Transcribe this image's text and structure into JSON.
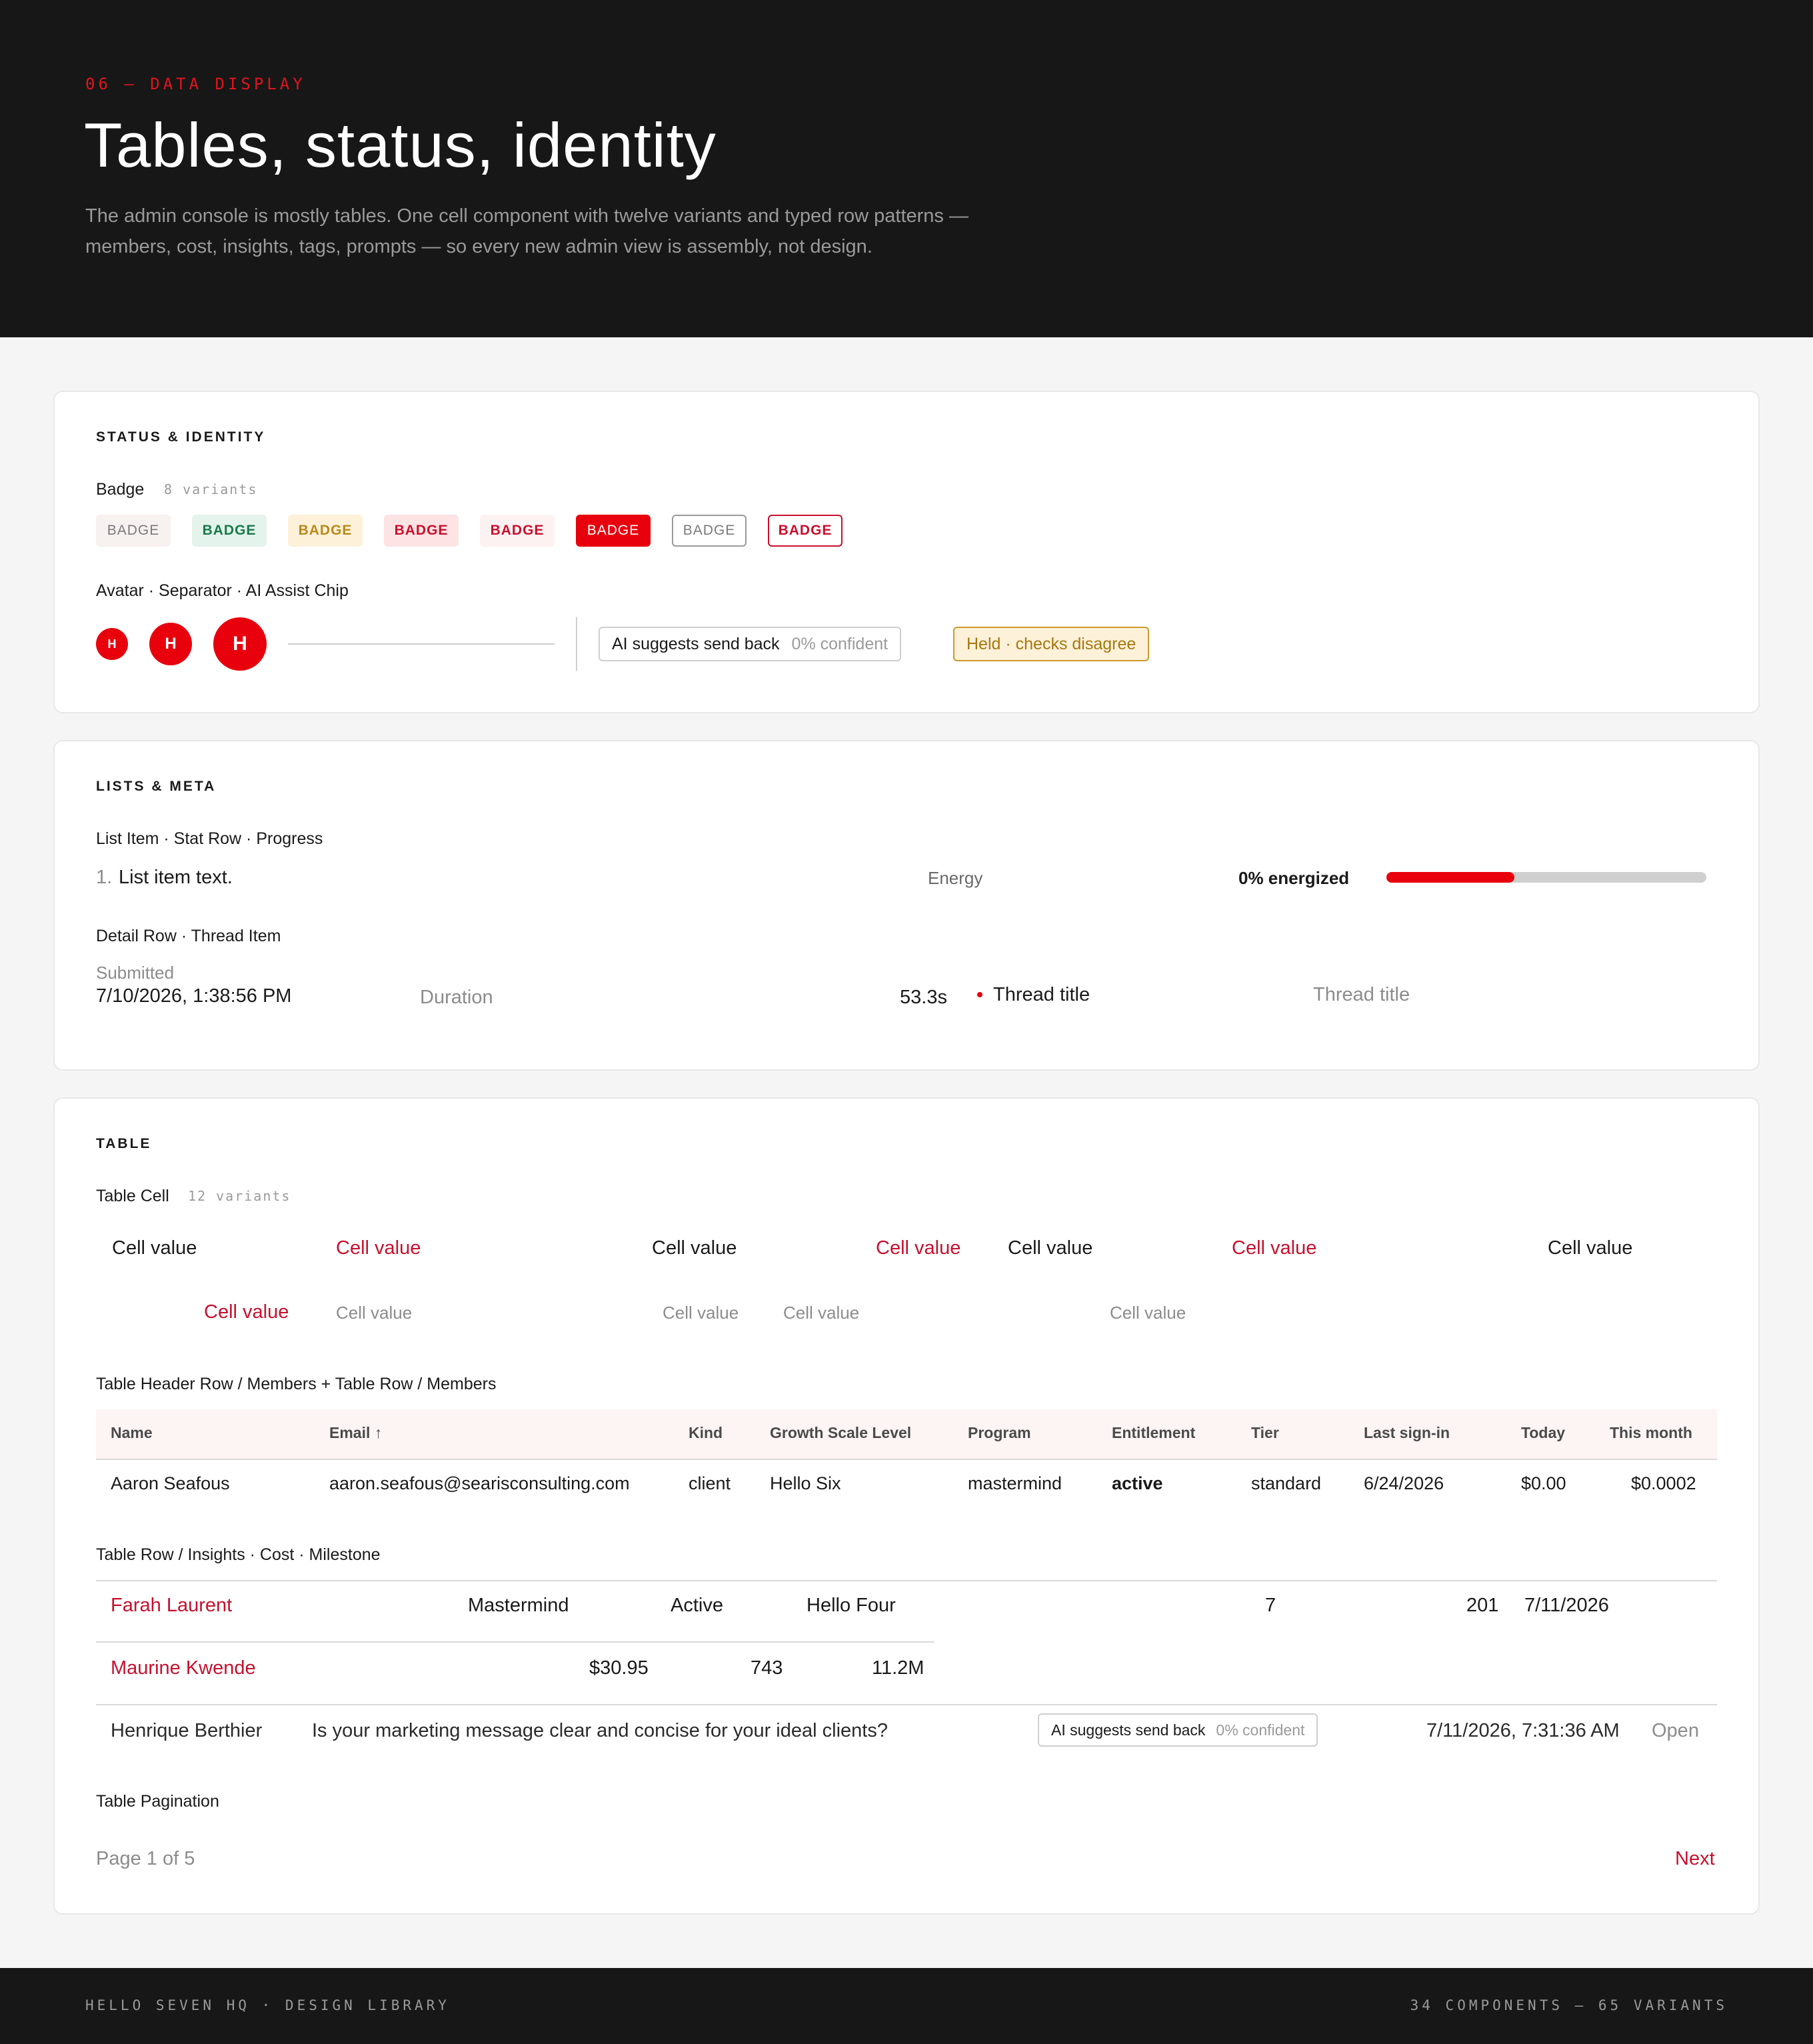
{
  "hero": {
    "eyebrow": "06 — DATA DISPLAY",
    "title": "Tables, status, identity",
    "description_line1": "The admin console is mostly tables. One cell component with twelve variants and typed row patterns —",
    "description_line2": "members, cost, insights, tags, prompts — so every new admin view is assembly, not design."
  },
  "status_identity": {
    "title": "STATUS & IDENTITY",
    "badge_label": "Badge",
    "badge_variants": "8 variants",
    "badges": [
      "BADGE",
      "BADGE",
      "BADGE",
      "BADGE",
      "BADGE",
      "BADGE",
      "BADGE",
      "BADGE"
    ],
    "avatar_label": "Avatar · Separator · AI Assist Chip",
    "avatars": [
      "H",
      "H",
      "H"
    ],
    "ai_chip_text": "AI suggests send back",
    "ai_chip_confidence": "0% confident",
    "held_chip_text": "Held · checks disagree"
  },
  "lists_meta": {
    "title": "LISTS & META",
    "list_label": "List Item · Stat Row · Progress",
    "list_number": "1.",
    "list_text": "List item text.",
    "stat_label": "Energy",
    "progress_label": "0% energized",
    "progress_value": 0.4,
    "detail_label": "Detail Row · Thread Item",
    "submitted_label": "Submitted",
    "submitted_value": "7/10/2026, 1:38:56 PM",
    "duration_label": "Duration",
    "duration_value": "53.3s",
    "thread_title": "Thread title",
    "thread_title_muted": "Thread title"
  },
  "table_section": {
    "title": "TABLE",
    "cell_label": "Table Cell",
    "cell_variants": "12 variants",
    "cells_row1": [
      "Cell value",
      "Cell value",
      "Cell value",
      "Cell value",
      "Cell value",
      "Cell value",
      "Cell value"
    ],
    "cells_row2": [
      "Cell value",
      "Cell value",
      "Cell value",
      "Cell value",
      "Cell value"
    ],
    "members_label": "Table Header Row / Members + Table Row / Members",
    "members_headers": [
      "Name",
      "Email ↑",
      "Kind",
      "Growth Scale Level",
      "Program",
      "Entitlement",
      "Tier",
      "Last sign-in",
      "Today",
      "This month"
    ],
    "members_row": [
      "Aaron Seafous",
      "aaron.seafous@searisconsulting.com",
      "client",
      "Hello Six",
      "mastermind",
      "active",
      "standard",
      "6/24/2026",
      "$0.00",
      "$0.0002"
    ],
    "insights_label": "Table Row / Insights · Cost · Milestone",
    "insights_row": [
      "Farah Laurent",
      "Mastermind",
      "Active",
      "Hello Four",
      "7",
      "201",
      "7/11/2026"
    ],
    "cost_row": [
      "Maurine Kwende",
      "$30.95",
      "743",
      "11.2M"
    ],
    "milestone_row": {
      "name": "Henrique Berthier",
      "question": "Is your marketing message clear and concise for your ideal clients?",
      "chip_text": "AI suggests send back",
      "chip_confidence": "0% confident",
      "date": "7/11/2026, 7:31:36 AM",
      "status": "Open"
    },
    "pagination_label": "Table Pagination",
    "page_text": "Page 1 of 5",
    "next_label": "Next"
  },
  "footer": {
    "left": "HELLO SEVEN HQ  ·  DESIGN LIBRARY",
    "right": "34 COMPONENTS — 65 VARIANTS"
  },
  "colors": {
    "brand_red": "#e8000d",
    "text_red": "#c8102e",
    "dark": "#171717"
  }
}
